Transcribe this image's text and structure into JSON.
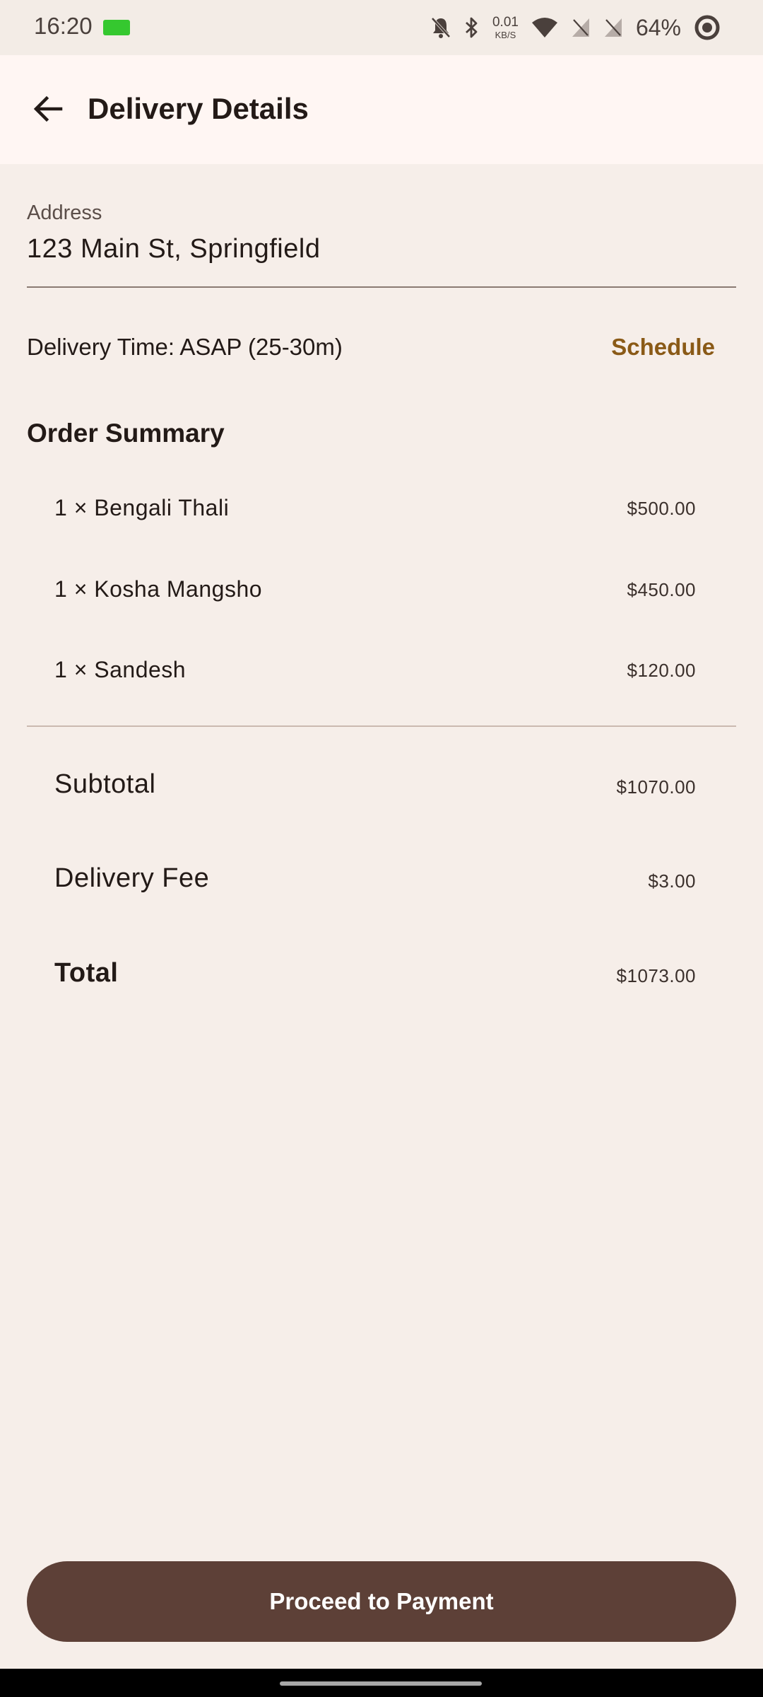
{
  "status_bar": {
    "time": "16:20",
    "net_speed_value": "0.01",
    "net_speed_unit": "KB/S",
    "battery": "64%"
  },
  "header": {
    "title": "Delivery Details"
  },
  "address": {
    "label": "Address",
    "value": "123 Main St, Springfield"
  },
  "delivery": {
    "time_text": "Delivery Time: ASAP (25-30m)",
    "schedule_label": "Schedule"
  },
  "order_summary": {
    "title": "Order Summary",
    "items": [
      {
        "name": "1 × Bengali Thali",
        "price": "$500.00"
      },
      {
        "name": "1 × Kosha Mangsho",
        "price": "$450.00"
      },
      {
        "name": "1 × Sandesh",
        "price": "$120.00"
      }
    ]
  },
  "totals": {
    "subtotal_label": "Subtotal",
    "subtotal_value": "$1070.00",
    "delivery_fee_label": "Delivery Fee",
    "delivery_fee_value": "$3.00",
    "total_label": "Total",
    "total_value": "$1073.00"
  },
  "actions": {
    "proceed_label": "Proceed to Payment"
  },
  "colors": {
    "background": "#f6eee9",
    "app_bar": "#fff6f3",
    "accent": "#8a5a17",
    "button": "#5d4037"
  }
}
